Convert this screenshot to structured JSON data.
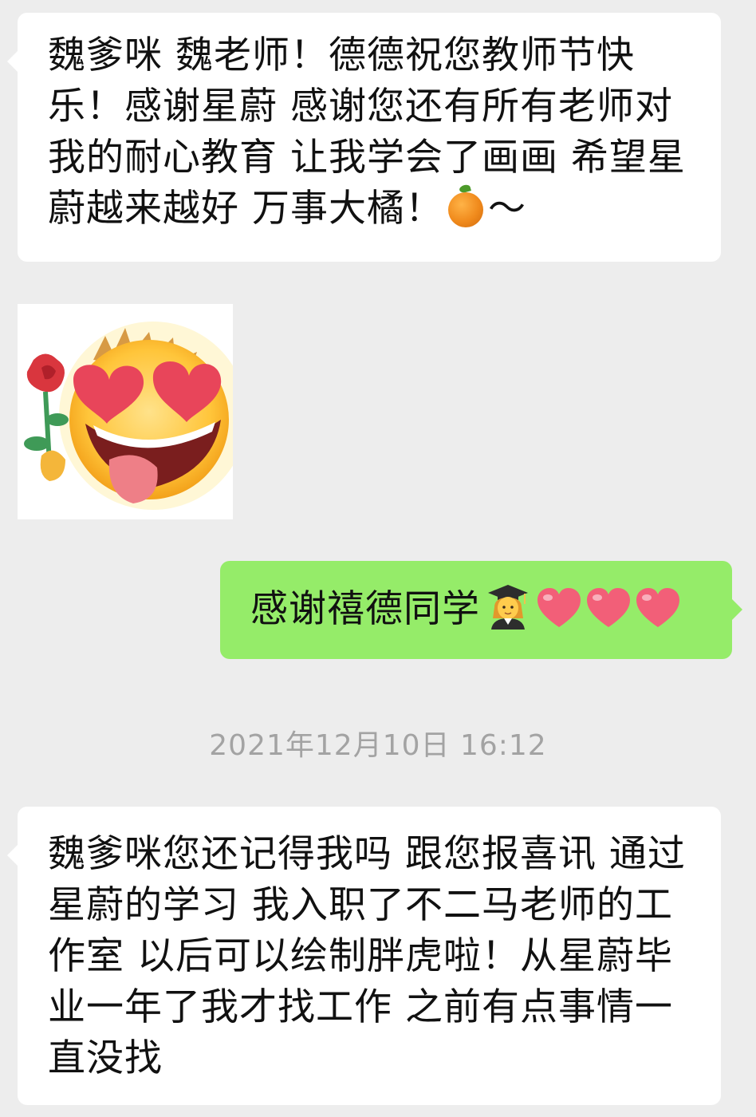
{
  "messages": [
    {
      "sender": "other",
      "text_part1": "魏爹咪 魏老师！德德祝您教师节快乐！感谢星蔚 感谢您还有所有老师对我的耐心教育 让我学会了画画 希望星蔚越来越好 万事大橘！",
      "emoji": "orange-emoji",
      "text_part2": "～"
    },
    {
      "sender": "other",
      "sticker": "heart-eyes-rose-sticker"
    },
    {
      "sender": "me",
      "text": "感谢禧德同学",
      "emojis": [
        "woman-graduate-emoji",
        "heart-emoji",
        "heart-emoji",
        "heart-emoji"
      ]
    },
    {
      "sender": "other",
      "text": "魏爹咪您还记得我吗 跟您报喜讯 通过星蔚的学习 我入职了不二马老师的工作室 以后可以绘制胖虎啦！从星蔚毕业一年了我才找工作 之前有点事情一直没找"
    }
  ],
  "timestamp": "2021年12月10日 16:12",
  "colors": {
    "background": "#ededed",
    "incoming_bubble": "#ffffff",
    "outgoing_bubble": "#95ec69",
    "text": "#111111",
    "timestamp_text": "#a3a3a3"
  }
}
